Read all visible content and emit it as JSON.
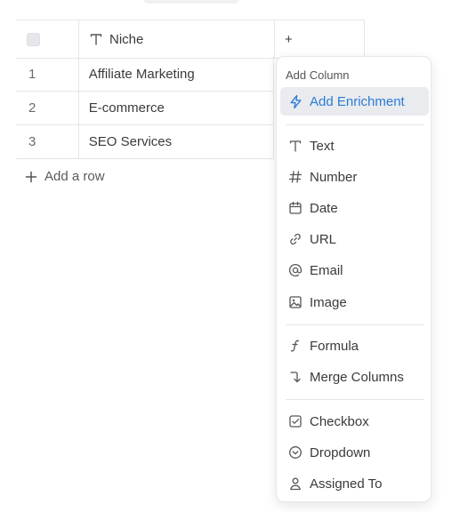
{
  "table": {
    "header": {
      "column_name": "Niche",
      "add_column_symbol": "+"
    },
    "rows": [
      {
        "index": "1",
        "value": "Affiliate Marketing"
      },
      {
        "index": "2",
        "value": "E-commerce"
      },
      {
        "index": "3",
        "value": "SEO Services"
      }
    ],
    "add_row_label": "Add a row"
  },
  "menu": {
    "section_label": "Add Column",
    "enrichment_label": "Add Enrichment",
    "types": [
      "Text",
      "Number",
      "Date",
      "URL",
      "Email",
      "Image"
    ],
    "advanced": [
      "Formula",
      "Merge Columns"
    ],
    "inputs": [
      "Checkbox",
      "Dropdown",
      "Assigned To"
    ]
  },
  "colors": {
    "accent": "#2b7bd6",
    "hover_bg": "#e9ebef",
    "border": "#e6e6e8"
  }
}
